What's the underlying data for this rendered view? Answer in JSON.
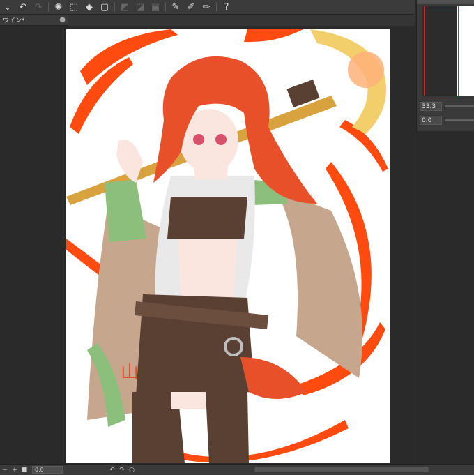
{
  "toolbar": {
    "items": [
      {
        "name": "dropdown-chevron-icon",
        "glyph": "⌄",
        "dim": false
      },
      {
        "name": "undo-icon",
        "glyph": "↶",
        "dim": false
      },
      {
        "name": "redo-icon",
        "glyph": "↷",
        "dim": true
      },
      {
        "name": "busy-indicator-icon",
        "glyph": "✺",
        "dim": false
      },
      {
        "name": "deselect-icon",
        "glyph": "⬚",
        "dim": false
      },
      {
        "name": "fill-icon",
        "glyph": "◆",
        "dim": false
      },
      {
        "name": "transform-icon",
        "glyph": "▢",
        "dim": false
      },
      {
        "name": "clear-outside-icon",
        "glyph": "◩",
        "dim": true
      },
      {
        "name": "fill-selection-icon",
        "glyph": "◪",
        "dim": true
      },
      {
        "name": "layer-border-icon",
        "glyph": "▣",
        "dim": true
      },
      {
        "name": "edit-pen-icon",
        "glyph": "✎",
        "dim": false
      },
      {
        "name": "brush-icon",
        "glyph": "✐",
        "dim": false
      },
      {
        "name": "ruler-pen-icon",
        "glyph": "✏",
        "dim": false
      },
      {
        "name": "help-icon",
        "glyph": "?",
        "dim": false
      }
    ]
  },
  "tab": {
    "label": "ウイン*",
    "close": "●"
  },
  "navigator": {
    "zoom": "33.3",
    "rotation": "0.0"
  },
  "statusbar": {
    "zoom_value": "0.0",
    "minus": "−",
    "plus": "+",
    "stop": "■",
    "rotate_left": "↶",
    "rotate_right": "↷",
    "reset": "○"
  },
  "colors": {
    "hair": "#e8502a",
    "effect": "#ff4a10",
    "cloak": "#c6a78e",
    "sleeve": "#8cbf7c",
    "dark": "#5a4032",
    "shirt": "#e9e9e9",
    "staff": "#d8a23e"
  }
}
